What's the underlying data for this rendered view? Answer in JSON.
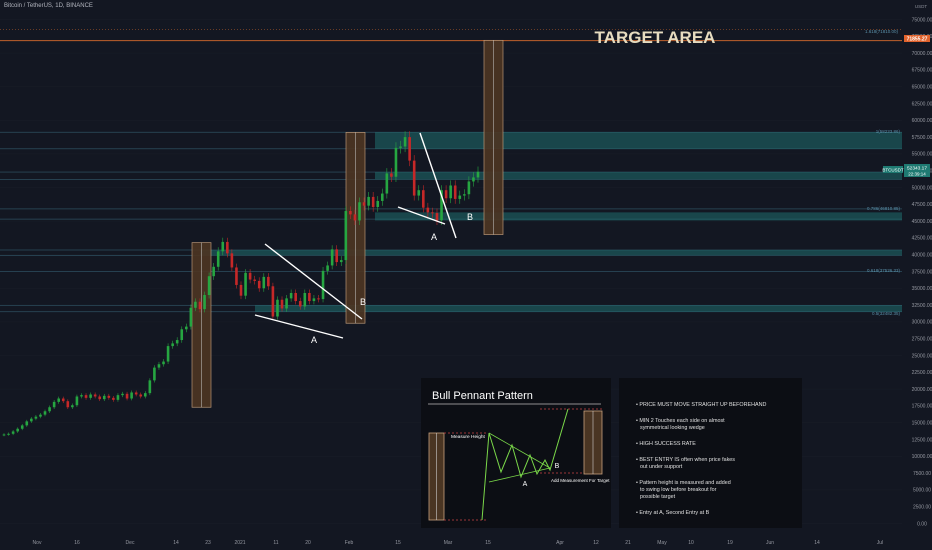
{
  "header": {
    "symbol_title": "Bitcoin / TetherUS, 1D, BINANCE"
  },
  "annotations": {
    "target_area": "TARGET AREA",
    "point_a": "A",
    "point_b": "B"
  },
  "price_labels": {
    "currency": "USDT",
    "top_level": "71855.27",
    "last_name": "BTCUSDT",
    "last_price": "52343.17",
    "countdown": "22:39:14"
  },
  "fib_labels": {
    "fib_1618": "1.618(71810.00)",
    "fib_1": "1(58233.86)",
    "fib_0786": "0.786(46810.85)",
    "fib_0618": "0.618(37536.33)",
    "fib_05": "0.5(32482.35)"
  },
  "info_panel": {
    "title": "Bull Pennant Pattern",
    "measure_height": "Measure Height",
    "add_measurement": "Add Measurement For Target",
    "label_a": "A",
    "label_b": "B"
  },
  "notes": [
    "PRICE MUST MOVE STRAIGHT UP BEFOREHAND",
    "MIN 2 Touches each side on almost symmetrical looking wedge",
    "HIGH SUCCESS RATE",
    "BEST ENTRY IS often when price fakes out under support",
    "Pattern height is measured and added to swing low before breakout for possible target",
    "Entry at A, Second Entry at B"
  ],
  "chart_data": {
    "type": "candlestick",
    "title": "Bitcoin / TetherUS, 1D, BINANCE",
    "y_axis": {
      "ticks": [
        0,
        2500,
        5000,
        7500,
        10000,
        12500,
        15000,
        17500,
        20000,
        22500,
        25000,
        27500,
        30000,
        32500,
        35000,
        37500,
        40000,
        42500,
        45000,
        47500,
        50000,
        52500,
        55000,
        57500,
        60000,
        62500,
        65000,
        67500,
        70000,
        72500,
        75000
      ],
      "range": [
        0,
        76500
      ]
    },
    "x_axis": {
      "ticks": [
        "Nov",
        "16",
        "Dec",
        "14",
        "23",
        "2021",
        "11",
        "20",
        "Feb",
        "15",
        "Mar",
        "15",
        "Apr",
        "12",
        "21",
        "May",
        "10",
        "19",
        "Jun",
        "14",
        "Jul"
      ]
    },
    "horizontal_levels": [
      71855,
      58234,
      55750,
      52300,
      51200,
      46811,
      45300,
      40700,
      39900,
      37536,
      32482,
      31500
    ],
    "series": [
      {
        "name": "BTCUSDT",
        "close_path": [
          13250,
          13350,
          13700,
          14100,
          14600,
          15200,
          15600,
          15900,
          16200,
          16700,
          17300,
          18100,
          18600,
          18200,
          17300,
          17600,
          18900,
          19100,
          18700,
          19200,
          18900,
          18500,
          19000,
          18700,
          18400,
          19100,
          19300,
          18600,
          19500,
          19200,
          18900,
          19400,
          21300,
          23200,
          23700,
          24100,
          26400,
          26800,
          27300,
          28900,
          29300,
          32100,
          33000,
          31900,
          34000,
          36800,
          38200,
          40500,
          41900,
          40200,
          38100,
          35500,
          33900,
          37300,
          36300,
          36100,
          35000,
          36700,
          35300,
          30800,
          33300,
          32000,
          33500,
          34300,
          33100,
          32300,
          34300,
          33100,
          33500,
          33400,
          37600,
          38400,
          40800,
          38900,
          39200,
          46500,
          46000,
          45100,
          47800,
          47300,
          48600,
          47100,
          48000,
          49100,
          52100,
          51600,
          55900,
          56100,
          57500,
          54000,
          48800,
          49600,
          47000,
          46300,
          46200,
          45100,
          49600,
          48400,
          50300,
          48300,
          48800,
          49000,
          50900,
          51500,
          52343
        ]
      }
    ]
  }
}
